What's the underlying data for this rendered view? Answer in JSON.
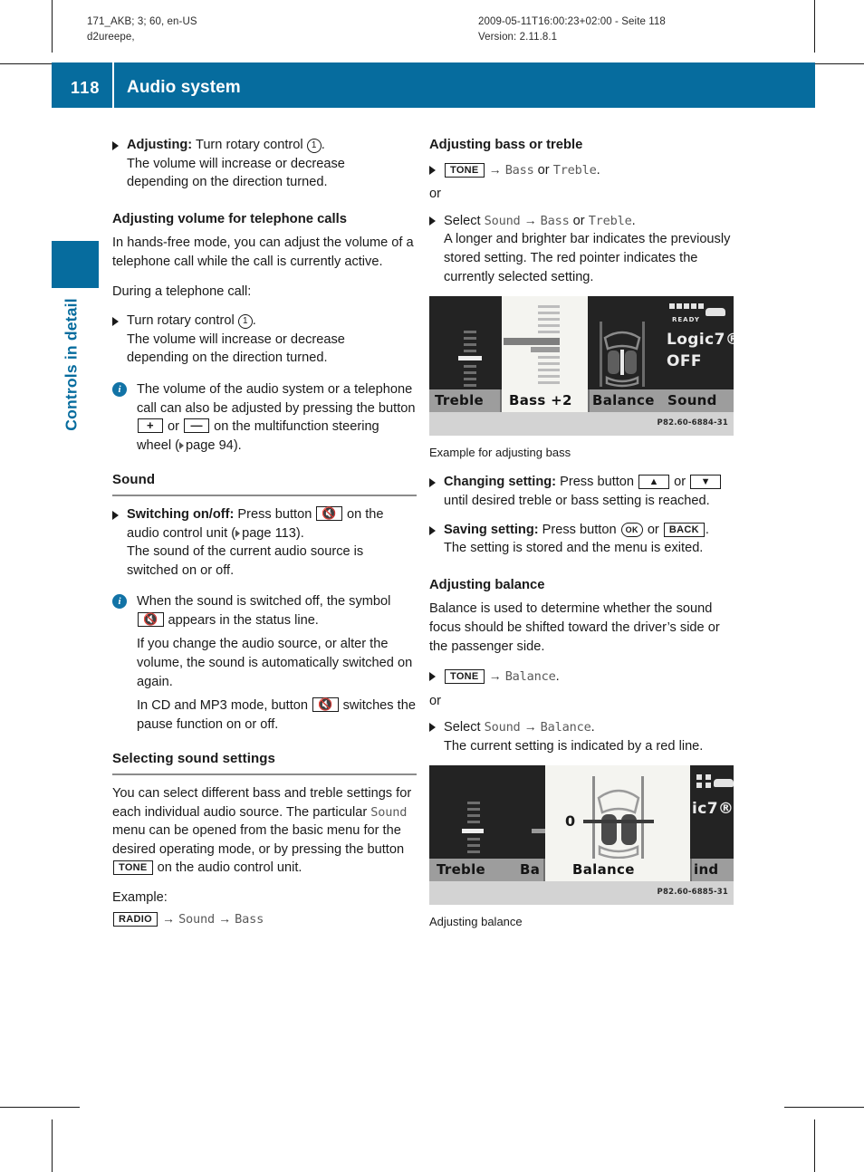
{
  "print_meta": {
    "left_line1": "171_AKB; 3; 60, en-US",
    "left_line2": "d2ureepe,",
    "right_line1": "2009-05-11T16:00:23+02:00 - Seite 118",
    "right_line2": "Version: 2.11.8.1"
  },
  "header": {
    "page_number": "118",
    "title": "Audio system",
    "accent_color": "#066C9E"
  },
  "chapter_tab": {
    "label": "Controls in detail"
  },
  "left_column": {
    "item_adjusting": {
      "lead": "Adjusting:",
      "text_before_circle": " Turn rotary control ",
      "circle_number": "1",
      "text_after_circle": ".",
      "line2": "The volume will increase or decrease",
      "line3": "depending on the direction turned."
    },
    "heading_phone_volume": "Adjusting volume for telephone calls",
    "para_handsfree": "In hands-free mode, you can adjust the volume of a telephone call while the call is currently active.",
    "para_during_call": "During a telephone call:",
    "item_turn_rotary": {
      "text_before_circle": "Turn rotary control ",
      "circle_number": "1",
      "text_after_circle": ".",
      "line2": "The volume will increase or decrease",
      "line3": "depending on the direction turned."
    },
    "note_volume": {
      "icon": "info-icon",
      "text_a": "The volume of the audio system or a telephone call can also be adjusted by pressing the button ",
      "key_plus": "+",
      "text_b": " or ",
      "key_minus": "—",
      "text_c": " on the multifunction steering wheel (",
      "page_ref": "page 94",
      "text_d": ")."
    },
    "heading_sound": "Sound",
    "item_switch_onoff": {
      "lead": "Switching on/off:",
      "text_a": " Press button ",
      "key_mute": "mute-speaker-icon",
      "text_b": " on the audio control unit (",
      "page_ref": "page 113",
      "text_c": ").",
      "line2": "The sound of the current audio source is switched on or off."
    },
    "note_mute": {
      "icon": "info-icon",
      "text_a": "When the sound is switched off, the symbol ",
      "key_mute": "mute-speaker-icon",
      "text_b": " appears in the status line.",
      "para2": "If you change the audio source, or alter the volume, the sound is automatically switched on again.",
      "para3_a": "In CD and MP3 mode, button ",
      "para3_key": "mute-speaker-icon",
      "para3_b": " switches the pause function on or off."
    },
    "heading_selecting": "Selecting sound settings",
    "para_selecting_a": "You can select different bass and treble settings for each individual audio source. The particular ",
    "para_selecting_menu": "Sound",
    "para_selecting_b": " menu can be opened from the basic menu for the desired operating mode, or by pressing the button ",
    "para_selecting_key": "TONE",
    "para_selecting_c": " on the audio control unit.",
    "example_label": "Example:",
    "example_path": {
      "key": "RADIO",
      "arrow": "→",
      "step1": "Sound",
      "step2": "Bass"
    }
  },
  "right_column": {
    "heading_bass_treble": "Adjusting bass or treble",
    "item_tone_path": {
      "key": "TONE",
      "arrow": "→",
      "option1": "Bass",
      "conj": " or ",
      "option2": "Treble",
      "end": "."
    },
    "or_1": "or",
    "item_select_path": {
      "lead": "Select ",
      "menu": "Sound",
      "arrow": "→",
      "option1": "Bass",
      "conj": " or ",
      "option2": "Treble",
      "end": ".",
      "line2": "A longer and brighter bar indicates the previously stored setting. The red pointer indicates the currently selected setting."
    },
    "figure_bass": {
      "id": "P82.60-6884-31",
      "caption": "Example for adjusting bass",
      "labels": {
        "treble": "Treble",
        "bass": "Bass +2",
        "balance": "Balance",
        "sound": "Sound"
      },
      "logic7_line1": "Logic7®",
      "logic7_line2": "OFF",
      "status_text": "READY"
    },
    "item_changing": {
      "lead": "Changing setting:",
      "text_a": " Press button ",
      "key_up": "▲",
      "text_b": " or ",
      "key_down": "▼",
      "text_c": " until desired treble or bass setting is reached."
    },
    "item_saving": {
      "lead": "Saving setting:",
      "text_a": " Press button ",
      "key_ok": "OK",
      "text_b": " or ",
      "key_back": "BACK",
      "text_c": ".",
      "line2": "The setting is stored and the menu is exited."
    },
    "heading_balance": "Adjusting balance",
    "para_balance": "Balance is used to determine whether the sound focus should be shifted toward the driver’s side or the passenger side.",
    "item_tone_balance": {
      "key": "TONE",
      "arrow": "→",
      "option": "Balance",
      "end": "."
    },
    "or_2": "or",
    "item_select_balance": {
      "lead": "Select ",
      "menu": "Sound",
      "arrow": "→",
      "option": "Balance",
      "end": ".",
      "line2": "The current setting is indicated by a red line."
    },
    "figure_balance": {
      "id": "P82.60-6885-31",
      "caption": "Adjusting balance",
      "labels": {
        "treble": "Treble",
        "bass_partial": "Ba",
        "balance": "Balance",
        "sound_partial": "ind"
      },
      "value": "0",
      "logic7_partial": "ic7®"
    }
  }
}
